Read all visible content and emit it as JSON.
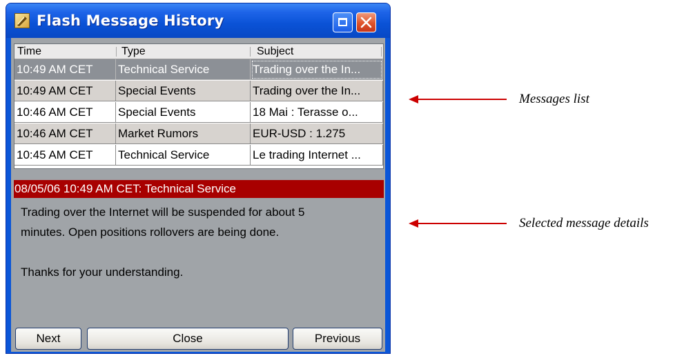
{
  "window": {
    "title": "Flash Message History",
    "icon": "flash-icon",
    "controls": {
      "maximize_icon": "maximize-icon",
      "close_icon": "close-icon"
    }
  },
  "table": {
    "columns": [
      "Time",
      "Type",
      "Subject"
    ],
    "rows": [
      {
        "time": "10:49 AM CET",
        "type": "Technical Service",
        "subject": "Trading over the In...",
        "selected": true
      },
      {
        "time": "10:49 AM CET",
        "type": "Special Events",
        "subject": "Trading over the In..."
      },
      {
        "time": "10:46 AM CET",
        "type": "Special Events",
        "subject": "18 Mai : Terasse o..."
      },
      {
        "time": "10:46 AM CET",
        "type": "Market Rumors",
        "subject": "EUR-USD : 1.275"
      },
      {
        "time": "10:45 AM CET",
        "type": "Technical Service",
        "subject": "Le trading Internet ..."
      }
    ]
  },
  "detail": {
    "header": "08/05/06 10:49 AM CET: Technical Service",
    "lines": [
      "Trading over the Internet will be suspended for about 5",
      "minutes. Open positions rollovers are being done.",
      "",
      "Thanks for your understanding."
    ]
  },
  "buttons": {
    "next": "Next",
    "close": "Close",
    "previous": "Previous"
  },
  "annotations": {
    "messages_list": "Messages list",
    "selected_details": "Selected message details"
  },
  "colors": {
    "selected_row": "#8c9096",
    "shaded_row": "#d7d3cf",
    "detail_header": "#a80000",
    "annotation_arrow": "#cc0000"
  }
}
